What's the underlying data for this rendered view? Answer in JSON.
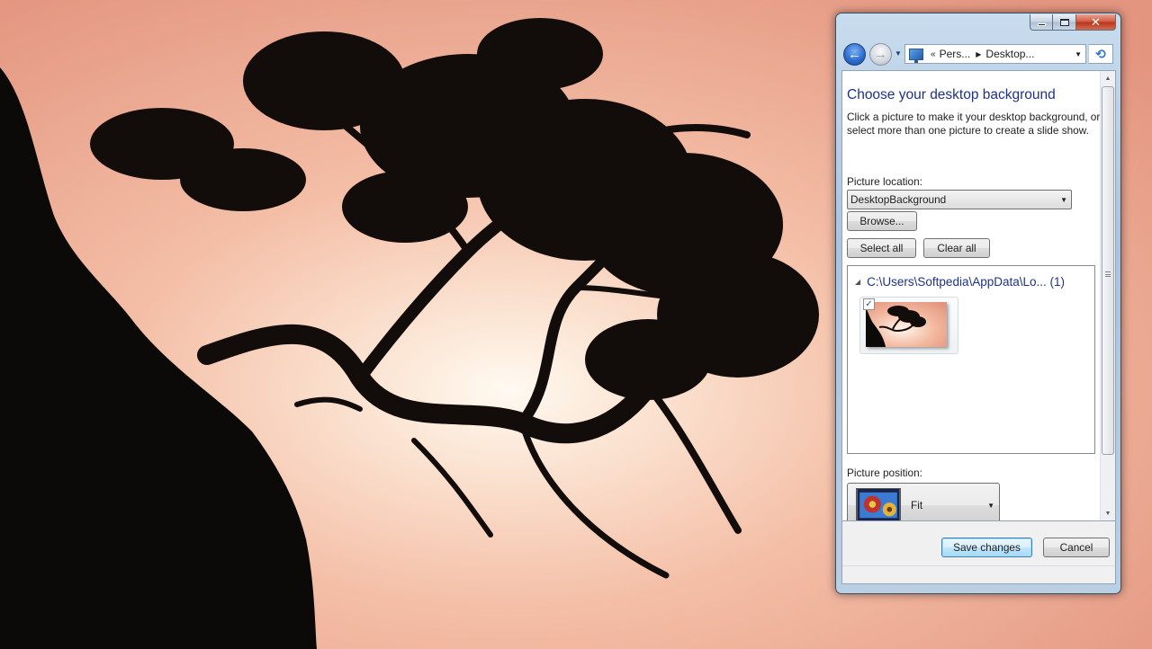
{
  "window": {
    "caption_buttons": {
      "minimize": "minimize-icon",
      "maximize": "maximize-icon",
      "close": "close-icon"
    }
  },
  "navbar": {
    "back_icon": "back-arrow-icon",
    "forward_icon": "forward-arrow-icon",
    "breadcrumb_prefix": "«",
    "breadcrumb": [
      "Pers...",
      "Desktop..."
    ],
    "refresh_icon": "refresh-icon"
  },
  "content": {
    "title": "Choose your desktop background",
    "description": "Click a picture to make it your desktop background, or select more than one picture to create a slide show.",
    "picture_location_label": "Picture location:",
    "picture_location_value": "DesktopBackground",
    "browse_label": "Browse...",
    "select_all_label": "Select all",
    "clear_all_label": "Clear all",
    "group_header": "C:\\Users\\Softpedia\\AppData\\Lo... (1)",
    "thumbnails": [
      {
        "checked": true,
        "check_mark": "✓"
      }
    ],
    "picture_position_label": "Picture position:",
    "picture_position_value": "Fit"
  },
  "footer": {
    "save_label": "Save changes",
    "cancel_label": "Cancel"
  },
  "colors": {
    "accent_title": "#1e3287",
    "window_frame": "#a9c4de",
    "close_button": "#c7432a",
    "wallpaper_sky": "#e9a68e"
  }
}
